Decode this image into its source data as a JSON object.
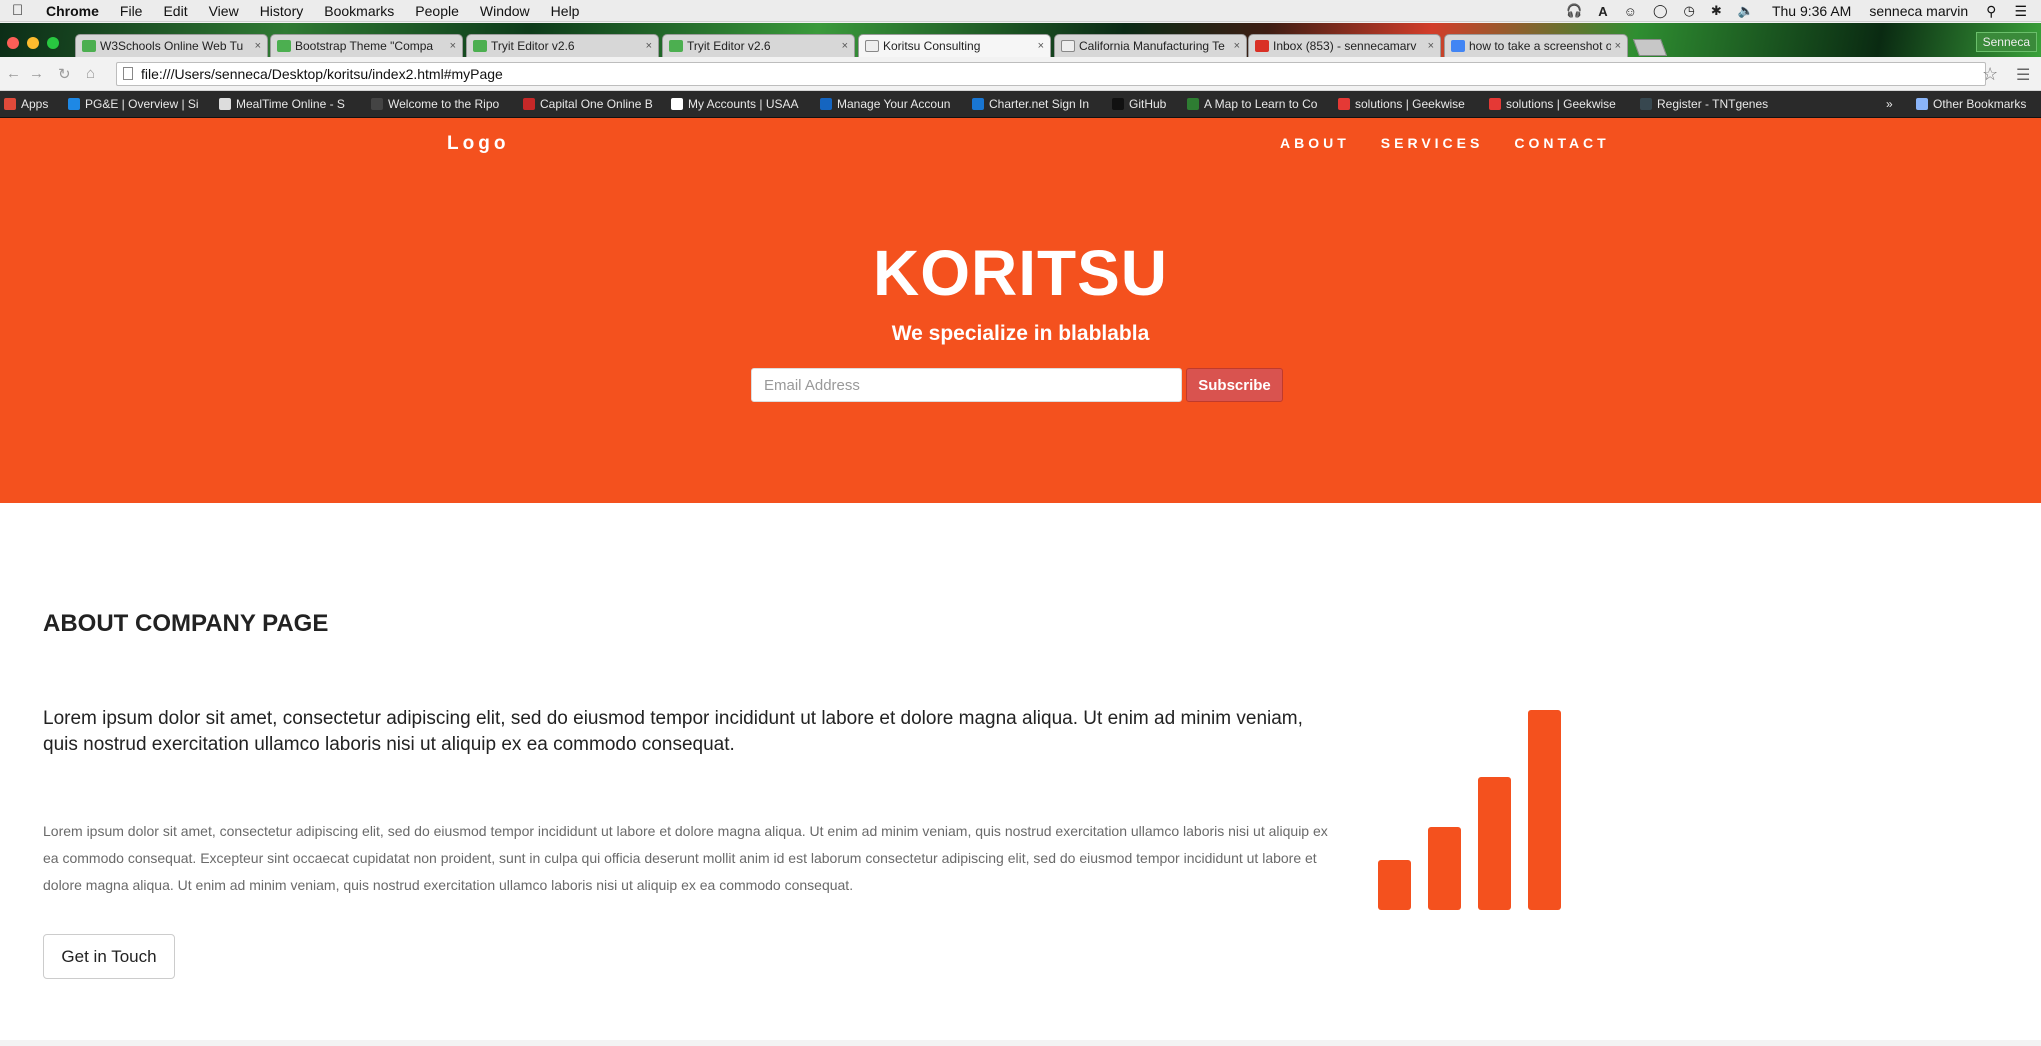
{
  "colors": {
    "accent": "#f4511e",
    "subscribe_bg": "#d9534f"
  },
  "menubar": {
    "app": "Chrome",
    "items": [
      "File",
      "Edit",
      "View",
      "History",
      "Bookmarks",
      "People",
      "Window",
      "Help"
    ],
    "clock": "Thu 9:36 AM",
    "user": "senneca marvin"
  },
  "tabs": [
    {
      "title": "W3Schools Online Web Tu",
      "favicon": "w3",
      "favicon_color": "#4caf50",
      "active": false
    },
    {
      "title": "Bootstrap Theme \"Compa",
      "favicon": "w3",
      "favicon_color": "#4caf50",
      "active": false
    },
    {
      "title": "Tryit Editor v2.6",
      "favicon": "w3",
      "favicon_color": "#4caf50",
      "active": false
    },
    {
      "title": "Tryit Editor v2.6",
      "favicon": "w3",
      "favicon_color": "#4caf50",
      "active": false
    },
    {
      "title": "Koritsu Consulting",
      "favicon": "page",
      "favicon_color": "#eeeeee",
      "active": true
    },
    {
      "title": "California Manufacturing Te",
      "favicon": "page",
      "favicon_color": "#eeeeee",
      "active": false
    },
    {
      "title": "Inbox (853) - sennecamarv",
      "favicon": "gmail",
      "favicon_color": "#d93025",
      "active": false
    },
    {
      "title": "how to take a screenshot o",
      "favicon": "google",
      "favicon_color": "#4285f4",
      "active": false
    }
  ],
  "profile_name": "Senneca",
  "url": "file:///Users/senneca/Desktop/koritsu/index2.html#myPage",
  "bookmarks": [
    {
      "label": "Apps",
      "icon_color": "#e04a3a"
    },
    {
      "label": "PG&E | Overview | Si",
      "icon_color": "#1e88e5"
    },
    {
      "label": "MealTime Online - S",
      "icon_color": "#dddddd"
    },
    {
      "label": "Welcome to the Ripo",
      "icon_color": "#444444"
    },
    {
      "label": "Capital One Online B",
      "icon_color": "#c62828"
    },
    {
      "label": "My Accounts | USAA",
      "icon_color": "#ffffff"
    },
    {
      "label": "Manage Your Accoun",
      "icon_color": "#1565c0"
    },
    {
      "label": "Charter.net Sign In",
      "icon_color": "#1976d2"
    },
    {
      "label": "GitHub",
      "icon_color": "#111111"
    },
    {
      "label": "A Map to Learn to Co",
      "icon_color": "#2e7d32"
    },
    {
      "label": "solutions | Geekwise",
      "icon_color": "#e53935"
    },
    {
      "label": "solutions | Geekwise",
      "icon_color": "#e53935"
    },
    {
      "label": "Register - TNTgenes",
      "icon_color": "#37474f"
    }
  ],
  "other_bookmarks": "Other Bookmarks",
  "site": {
    "logo": "Logo",
    "nav": [
      "ABOUT",
      "SERVICES",
      "CONTACT"
    ],
    "hero_title": "KORITSU",
    "hero_subtitle": "We specialize in blablabla",
    "email_placeholder": "Email Address",
    "subscribe_label": "Subscribe",
    "about_heading": "ABOUT COMPANY PAGE",
    "about_lead": "Lorem ipsum dolor sit amet, consectetur adipiscing elit, sed do eiusmod tempor incididunt ut labore et dolore magna aliqua. Ut enim ad minim veniam, quis nostrud exercitation ullamco laboris nisi ut aliquip ex ea commodo consequat.",
    "about_body": "Lorem ipsum dolor sit amet, consectetur adipiscing elit, sed do eiusmod tempor incididunt ut labore et dolore magna aliqua. Ut enim ad minim veniam, quis nostrud exercitation ullamco laboris nisi ut aliquip ex ea commodo consequat. Excepteur sint occaecat cupidatat non proident, sunt in culpa qui officia deserunt mollit anim id est laborum consectetur adipiscing elit, sed do eiusmod tempor incididunt ut labore et dolore magna aliqua. Ut enim ad minim veniam, quis nostrud exercitation ullamco laboris nisi ut aliquip ex ea commodo consequat.",
    "cta_label": "Get in Touch",
    "signal_icon": "signal-bars-icon"
  }
}
